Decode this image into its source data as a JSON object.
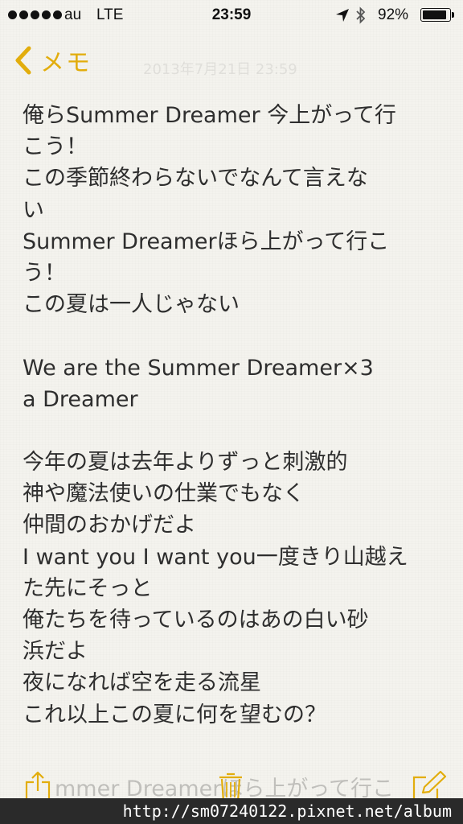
{
  "status_bar": {
    "carrier": "au",
    "network": "LTE",
    "time": "23:59",
    "battery_percent": "92%",
    "battery_level": 0.92,
    "signal_dots": 5
  },
  "nav": {
    "back_label": "メモ",
    "ghost_title": "2013年7月21日 23:59"
  },
  "note": {
    "lines": [
      "俺らSummer Dreamer 今上がって行",
      "こう！",
      "この季節終わらないでなんて言えな",
      "い",
      "Summer Dreamerほら上がって行こ",
      "う！",
      "この夏は一人じゃない",
      "",
      "We are the Summer Dreamer×3",
      "a Dreamer",
      "",
      "今年の夏は去年よりずっと刺激的",
      "神や魔法使いの仕業でもなく",
      "仲間のおかげだよ",
      "I want you I want you一度きり山越え",
      "た先にそっと",
      "俺たちを待っているのはあの白い砂",
      "浜だよ",
      "夜になれば空を走る流星",
      "これ以上この夏に何を望むの？"
    ],
    "ghost_bottom": "mmer Dreamerほら上がって行こ"
  },
  "toolbar": {
    "share_icon": "share-icon",
    "trash_icon": "trash-icon",
    "compose_icon": "compose-icon"
  },
  "watermark": "http://sm07240122.pixnet.net/album",
  "colors": {
    "accent": "#e2ad0c",
    "paper": "#f4f3ee",
    "text": "#2e2e2e"
  }
}
